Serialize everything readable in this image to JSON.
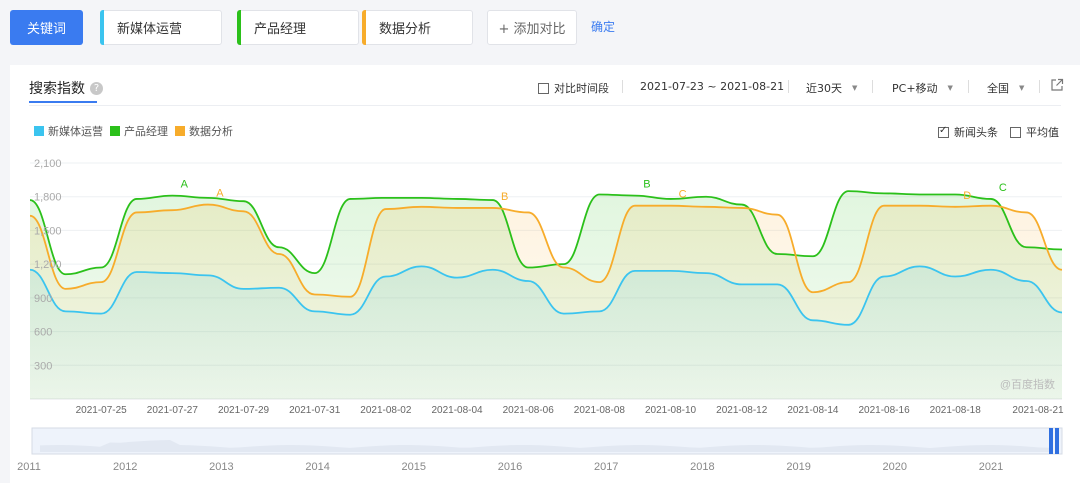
{
  "toolbar": {
    "keyword_label": "关键词",
    "keywords": [
      {
        "name": "新媒体运营",
        "color": "#3bc4ef"
      },
      {
        "name": "产品经理",
        "color": "#2bc01a"
      },
      {
        "name": "数据分析",
        "color": "#f7ac2b"
      }
    ],
    "add_label": "+ 添加对比",
    "confirm_label": "确定"
  },
  "panel": {
    "title": "搜索指数",
    "help_icon": "?",
    "compare_time_label": "对比时间段",
    "date_range": "2021-07-23 ~ 2021-08-21",
    "period": "近30天",
    "device": "PC+移动",
    "region": "全国",
    "export_icon": "external-link-icon",
    "news_label": "新闻头条",
    "average_label": "平均值",
    "watermark": "@百度指数"
  },
  "chart_data": {
    "type": "area",
    "title": "",
    "xlabel": "",
    "ylabel": "",
    "ylim": [
      0,
      2100
    ],
    "yticks": [
      300,
      600,
      900,
      1200,
      1500,
      1800,
      2100
    ],
    "ytick_labels": [
      "300",
      "600",
      "900",
      "1,200",
      "1,500",
      "1,800",
      "2,100"
    ],
    "grid": true,
    "legend": "top-left",
    "x": [
      "2021-07-23",
      "2021-07-24",
      "2021-07-25",
      "2021-07-26",
      "2021-07-27",
      "2021-07-28",
      "2021-07-29",
      "2021-07-30",
      "2021-07-31",
      "2021-08-01",
      "2021-08-02",
      "2021-08-03",
      "2021-08-04",
      "2021-08-05",
      "2021-08-06",
      "2021-08-07",
      "2021-08-08",
      "2021-08-09",
      "2021-08-10",
      "2021-08-11",
      "2021-08-12",
      "2021-08-13",
      "2021-08-14",
      "2021-08-15",
      "2021-08-16",
      "2021-08-17",
      "2021-08-18",
      "2021-08-19",
      "2021-08-20",
      "2021-08-21"
    ],
    "xtick_labels": [
      "2021-07-25",
      "2021-07-27",
      "2021-07-29",
      "2021-07-31",
      "2021-08-02",
      "2021-08-04",
      "2021-08-06",
      "2021-08-08",
      "2021-08-10",
      "2021-08-12",
      "2021-08-14",
      "2021-08-16",
      "2021-08-18",
      "2021-08-21"
    ],
    "series": [
      {
        "name": "新媒体运营",
        "color": "#3bc4ef",
        "values": [
          1150,
          780,
          760,
          1130,
          1120,
          1100,
          980,
          990,
          780,
          750,
          1090,
          1180,
          1080,
          1150,
          1050,
          760,
          780,
          1140,
          1140,
          1120,
          1020,
          1020,
          700,
          660,
          1090,
          1180,
          1090,
          1150,
          1050,
          770
        ]
      },
      {
        "name": "产品经理",
        "color": "#2bc01a",
        "values": [
          1770,
          1110,
          1170,
          1780,
          1810,
          1790,
          1760,
          1350,
          1120,
          1780,
          1790,
          1790,
          1780,
          1770,
          1170,
          1200,
          1820,
          1810,
          1780,
          1800,
          1730,
          1290,
          1270,
          1850,
          1830,
          1820,
          1820,
          1780,
          1350,
          1330
        ]
      },
      {
        "name": "数据分析",
        "color": "#f7ac2b",
        "values": [
          1630,
          980,
          1040,
          1660,
          1680,
          1730,
          1670,
          1290,
          930,
          910,
          1690,
          1710,
          1700,
          1700,
          1660,
          1170,
          1040,
          1720,
          1720,
          1710,
          1700,
          1640,
          950,
          1040,
          1720,
          1720,
          1710,
          1720,
          1660,
          1150
        ]
      }
    ],
    "annotations": [
      {
        "label": "A",
        "series": 1,
        "index": 4
      },
      {
        "label": "A",
        "series": 2,
        "index": 5
      },
      {
        "label": "B",
        "series": 2,
        "index": 13
      },
      {
        "label": "B",
        "series": 1,
        "index": 17
      },
      {
        "label": "C",
        "series": 2,
        "index": 18
      },
      {
        "label": "D",
        "series": 2,
        "index": 26
      },
      {
        "label": "C",
        "series": 1,
        "index": 27
      }
    ],
    "overview": {
      "year_labels": [
        "2011",
        "2012",
        "2013",
        "2014",
        "2015",
        "2016",
        "2017",
        "2018",
        "2019",
        "2020",
        "2021"
      ]
    }
  }
}
